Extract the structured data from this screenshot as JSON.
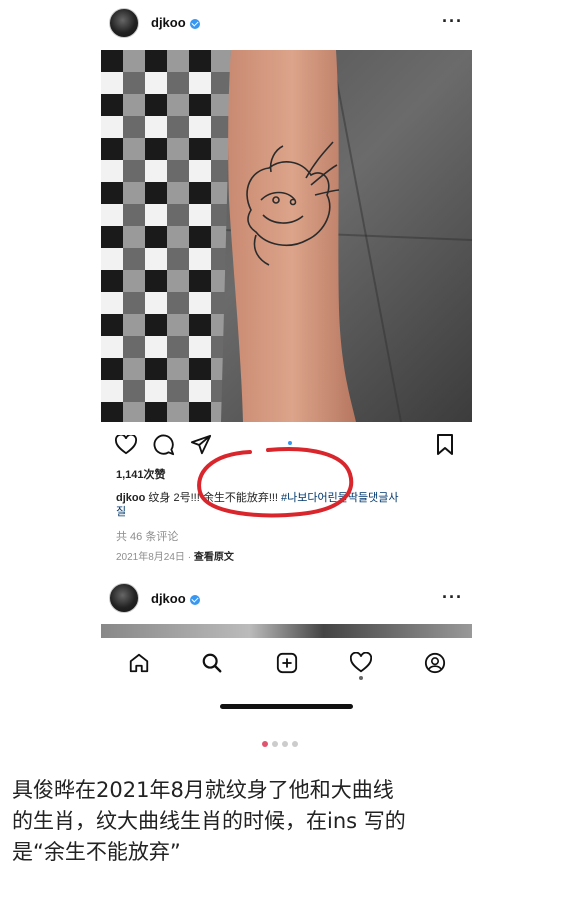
{
  "post1": {
    "username": "djkoo",
    "likes": "1,141次赞",
    "caption_user": "djkoo",
    "caption_part1": "纹身 2",
    "caption_part2": "号!!! 余生不能放弃!!! ",
    "caption_tag": "#나보다어린들딱들댓글사",
    "caption_tag2": "질",
    "comments": "共 46 条评论",
    "date": "2021年8月24日",
    "see_original": "查看原文"
  },
  "post2": {
    "username": "djkoo"
  },
  "nav": {
    "icons": [
      "home-icon",
      "search-icon",
      "add-post-icon",
      "activity-heart-icon",
      "profile-icon"
    ]
  },
  "article": {
    "line1": "具俊晔在2021年8月就纹身了他和大曲线",
    "line2": "的生肖，纹大曲线生肖的时候，在ins 写的",
    "line3": "是“余生不能放弃”"
  },
  "colors": {
    "highlight_circle": "#d9262c",
    "verified": "#3897f0"
  }
}
